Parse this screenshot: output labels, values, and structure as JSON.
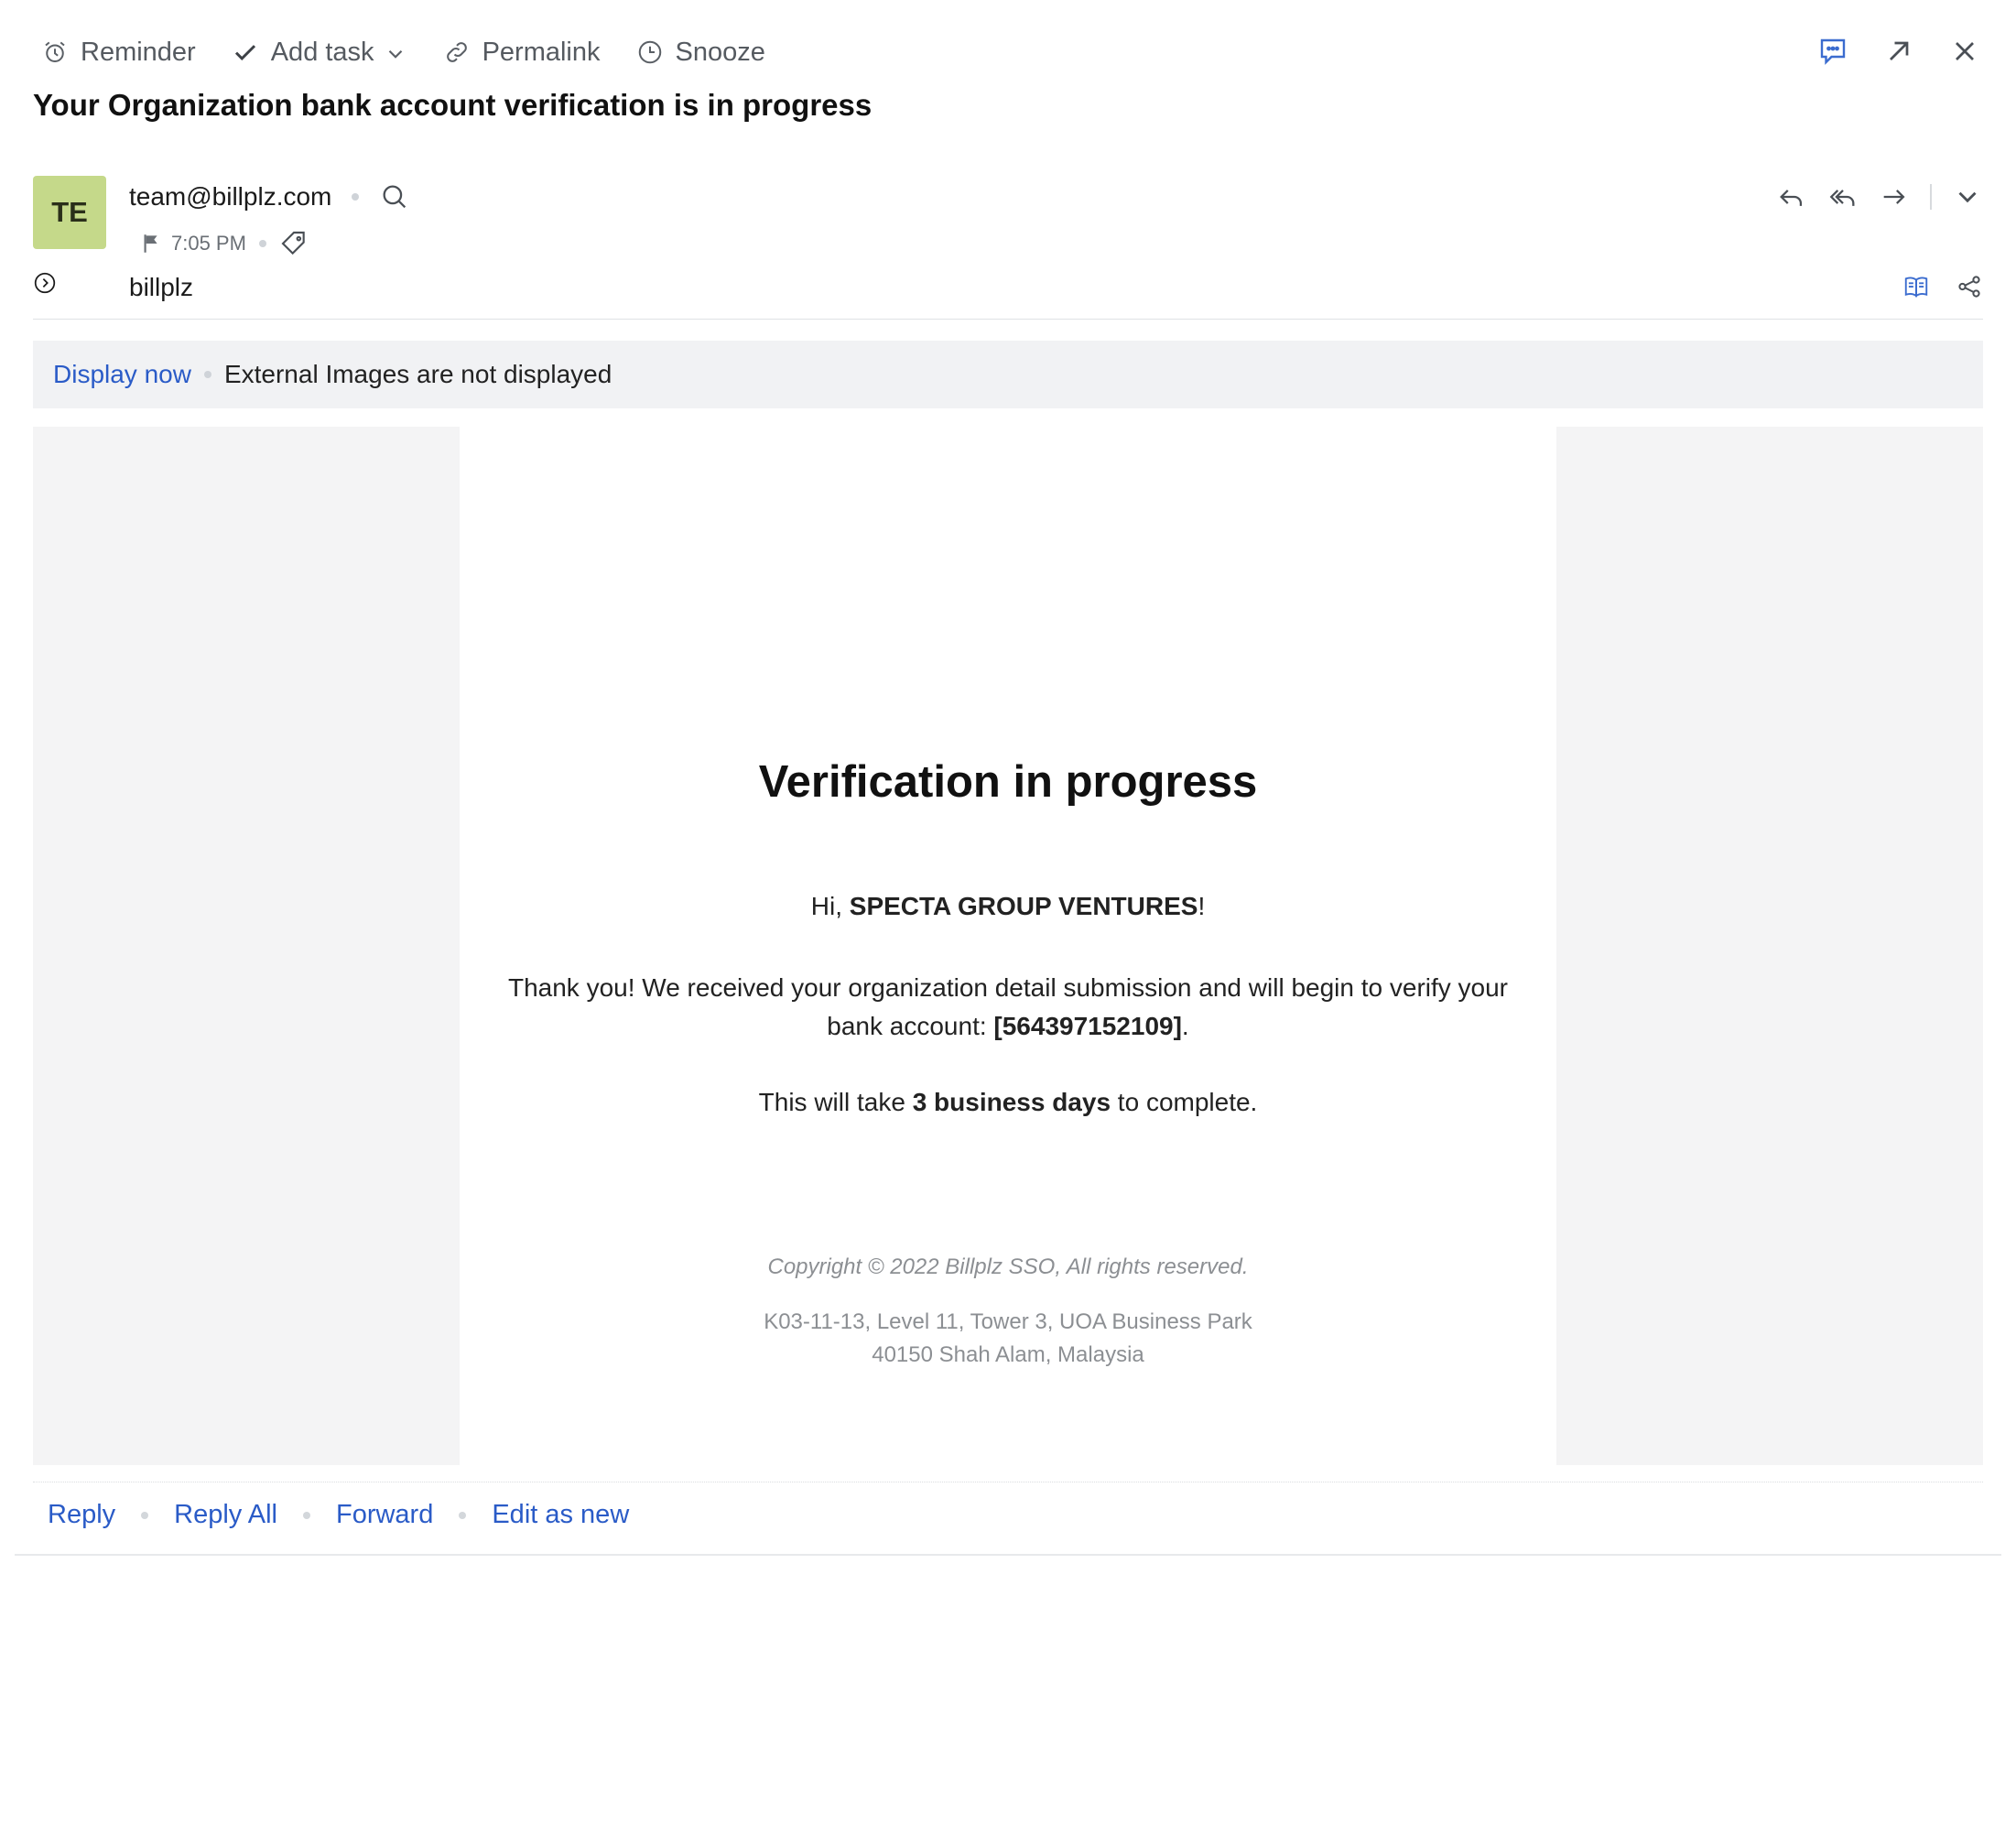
{
  "toolbar": {
    "reminder": "Reminder",
    "add_task": "Add task",
    "permalink": "Permalink",
    "snooze": "Snooze"
  },
  "subject": "Your Organization bank account verification is in progress",
  "sender": {
    "avatar_initials": "TE",
    "avatar_color": "#c5d98a",
    "email": "team@billplz.com",
    "time": "7:05 PM",
    "to": "billplz"
  },
  "image_banner": {
    "display_now": "Display now",
    "message": "External Images are not displayed"
  },
  "email": {
    "heading": "Verification in progress",
    "greeting_prefix": "Hi, ",
    "greeting_name": "SPECTA GROUP VENTURES",
    "greeting_suffix": "!",
    "body_prefix": "Thank you! We received your organization detail submission and will begin to verify your bank account: ",
    "account": "[564397152109]",
    "body_suffix": ".",
    "time_prefix": "This will take ",
    "time_bold": "3 business days",
    "time_suffix": " to complete.",
    "copyright": "Copyright © 2022 Billplz SSO, All rights reserved.",
    "address_line1": "K03-11-13, Level 11, Tower 3, UOA Business Park",
    "address_line2": "40150 Shah Alam, Malaysia"
  },
  "footer": {
    "reply": "Reply",
    "reply_all": "Reply All",
    "forward": "Forward",
    "edit_as_new": "Edit as new"
  },
  "colors": {
    "link": "#2a5bc7",
    "accent_icon": "#3b6ccf"
  }
}
